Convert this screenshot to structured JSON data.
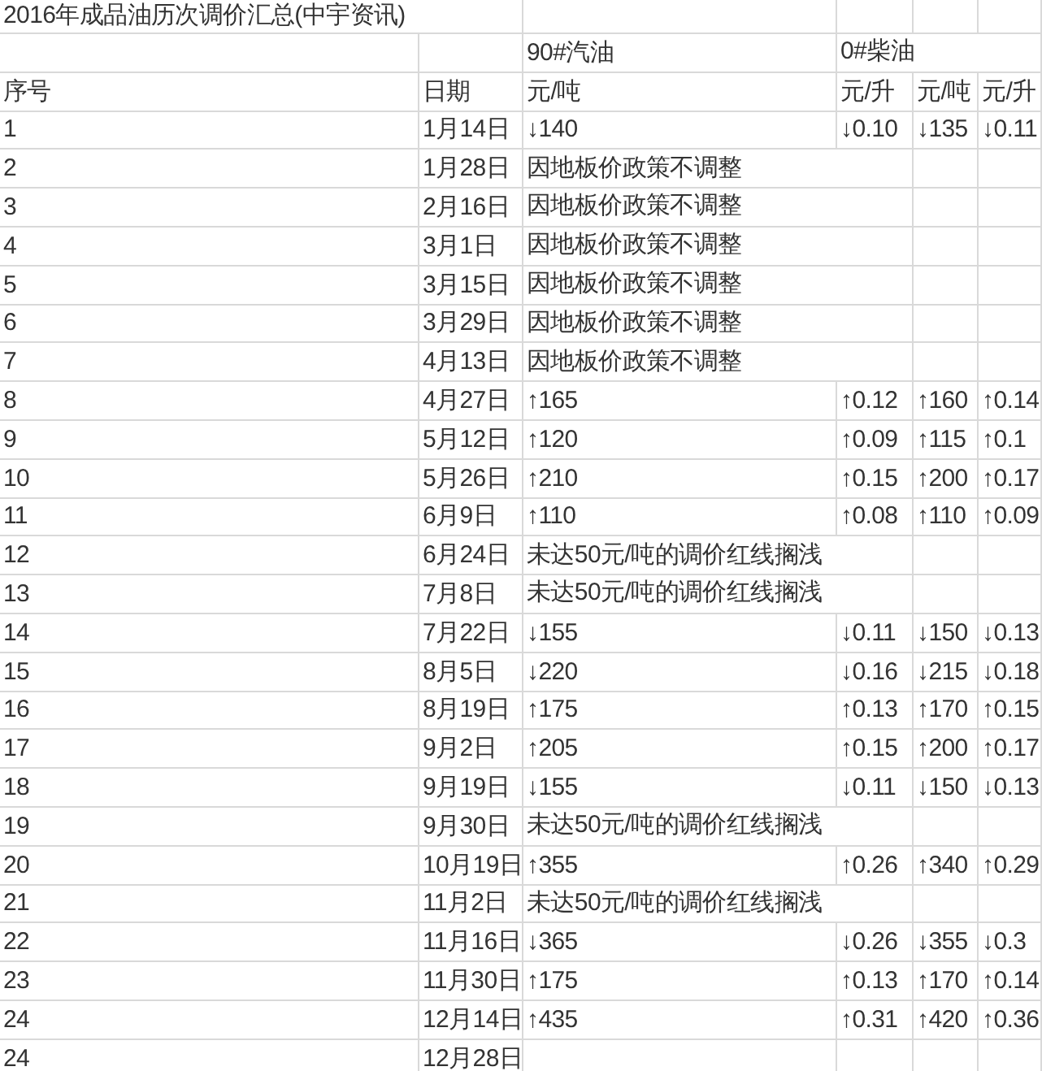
{
  "title": "2016年成品油历次调价汇总(中宇资讯)",
  "group_headers": [
    {
      "label": "90#汽油"
    },
    {
      "label": "0#柴油"
    }
  ],
  "columns": [
    "序号",
    "日期",
    "元/吨",
    "元/升",
    "元/吨",
    "元/升"
  ],
  "rows": [
    {
      "kind": "change",
      "no": "1",
      "date": "1月14日",
      "values": [
        "↓140",
        "↓0.10",
        "↓135",
        "↓0.11"
      ]
    },
    {
      "kind": "note",
      "no": "2",
      "date": "1月28日",
      "note": "因地板价政策不调整"
    },
    {
      "kind": "note",
      "no": "3",
      "date": "2月16日",
      "note": "因地板价政策不调整"
    },
    {
      "kind": "note",
      "no": "4",
      "date": "3月1日",
      "note": "因地板价政策不调整"
    },
    {
      "kind": "note",
      "no": "5",
      "date": "3月15日",
      "note": "因地板价政策不调整"
    },
    {
      "kind": "note",
      "no": "6",
      "date": "3月29日",
      "note": "因地板价政策不调整"
    },
    {
      "kind": "note",
      "no": "7",
      "date": "4月13日",
      "note": "因地板价政策不调整"
    },
    {
      "kind": "change",
      "no": "8",
      "date": "4月27日",
      "values": [
        "↑165",
        "↑0.12",
        "↑160",
        "↑0.14"
      ]
    },
    {
      "kind": "change",
      "no": "9",
      "date": "5月12日",
      "values": [
        "↑120",
        "↑0.09",
        "↑115",
        "↑0.1"
      ]
    },
    {
      "kind": "change",
      "no": "10",
      "date": "5月26日",
      "values": [
        "↑210",
        "↑0.15",
        "↑200",
        "↑0.17"
      ]
    },
    {
      "kind": "change",
      "no": "11",
      "date": "6月9日",
      "values": [
        "↑110",
        "↑0.08",
        "↑110",
        "↑0.09"
      ]
    },
    {
      "kind": "note",
      "no": "12",
      "date": "6月24日",
      "note": "未达50元/吨的调价红线搁浅"
    },
    {
      "kind": "note",
      "no": "13",
      "date": "7月8日",
      "note": "未达50元/吨的调价红线搁浅"
    },
    {
      "kind": "change",
      "no": "14",
      "date": "7月22日",
      "values": [
        "↓155",
        "↓0.11",
        "↓150",
        "↓0.13"
      ]
    },
    {
      "kind": "change",
      "no": "15",
      "date": "8月5日",
      "values": [
        "↓220",
        "↓0.16",
        "↓215",
        "↓0.18"
      ]
    },
    {
      "kind": "change",
      "no": "16",
      "date": "8月19日",
      "values": [
        "↑175",
        "↑0.13",
        "↑170",
        "↑0.15"
      ]
    },
    {
      "kind": "change",
      "no": "17",
      "date": "9月2日",
      "values": [
        "↑205",
        "↑0.15",
        "↑200",
        "↑0.17"
      ]
    },
    {
      "kind": "change",
      "no": "18",
      "date": "9月19日",
      "values": [
        "↓155",
        "↓0.11",
        "↓150",
        "↓0.13"
      ]
    },
    {
      "kind": "note",
      "no": "19",
      "date": "9月30日",
      "note": "未达50元/吨的调价红线搁浅"
    },
    {
      "kind": "change",
      "no": "20",
      "date": "10月19日",
      "values": [
        "↑355",
        "↑0.26",
        "↑340",
        "↑0.29"
      ]
    },
    {
      "kind": "note",
      "no": "21",
      "date": "11月2日",
      "note": "未达50元/吨的调价红线搁浅"
    },
    {
      "kind": "change",
      "no": "22",
      "date": "11月16日",
      "values": [
        "↓365",
        "↓0.26",
        "↓355",
        "↓0.3"
      ]
    },
    {
      "kind": "change",
      "no": "23",
      "date": "11月30日",
      "values": [
        "↑175",
        "↑0.13",
        "↑170",
        "↑0.14"
      ]
    },
    {
      "kind": "change",
      "no": "24",
      "date": "12月14日",
      "values": [
        "↑435",
        "↑0.31",
        "↑420",
        "↑0.36"
      ]
    },
    {
      "kind": "blank",
      "no": "24",
      "date": "12月28日"
    }
  ]
}
